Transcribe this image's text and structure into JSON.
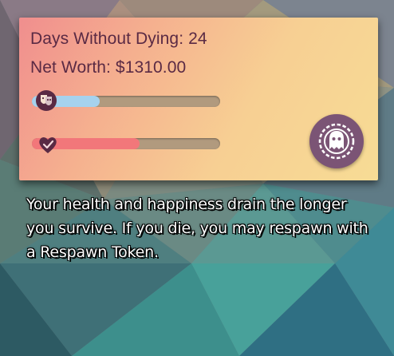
{
  "status_panel": {
    "days_without_dying": "Days Without Dying: 24",
    "net_worth": "Net Worth: $1310.00",
    "happiness": {
      "icon": "theater-mask-icon",
      "level": 0.36,
      "fill_color": "#a6d2ee"
    },
    "health": {
      "icon": "heart-icon",
      "level": 0.57,
      "fill_color": "#f2777a"
    },
    "respawn_token_button": {
      "icon": "ghost-token-icon",
      "color": "#7b5475"
    }
  },
  "caption": "Your health and happiness drain the longer you survive. If you die, you may respawn with a Respawn Token.",
  "colors": {
    "text": "#5a2a44",
    "bar_track": "#b19a7e",
    "panel_start": "#f08e8e",
    "panel_end": "#f7dc95"
  }
}
